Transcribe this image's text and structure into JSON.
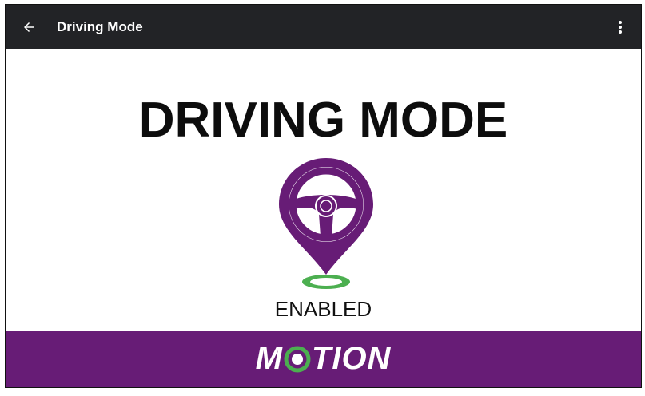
{
  "appbar": {
    "title": "Driving Mode",
    "back_icon": "arrow-back-icon",
    "overflow_icon": "more-vert-icon"
  },
  "main": {
    "headline": "DRIVING MODE",
    "status": "ENABLED",
    "logo_icon": "steering-wheel-pin-icon"
  },
  "banner": {
    "brand_before": "M",
    "brand_after": "TION",
    "brand_o_icon": "target-ring-icon"
  },
  "colors": {
    "appbar_bg": "#222326",
    "purple": "#671c76",
    "green": "#4caf50"
  }
}
